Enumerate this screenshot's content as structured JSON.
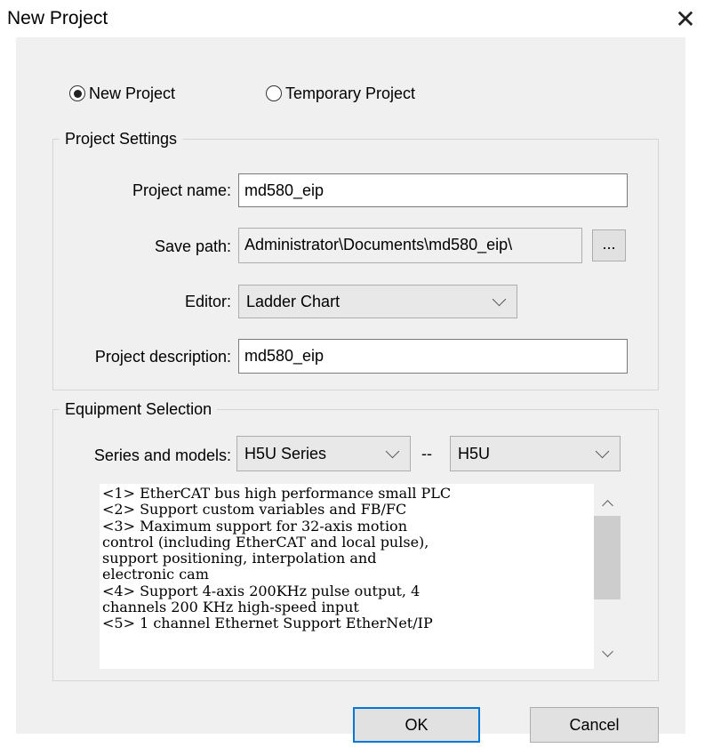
{
  "dialog": {
    "title": "New Project",
    "close_icon": "close-icon"
  },
  "project_type": {
    "options": [
      {
        "label": "New Project",
        "selected": true
      },
      {
        "label": "Temporary Project",
        "selected": false
      }
    ]
  },
  "project_settings": {
    "legend": "Project Settings",
    "name_label": "Project name:",
    "name_value": "md580_eip",
    "path_label": "Save path:",
    "path_value": "Administrator\\Documents\\md580_eip\\",
    "browse_label": "...",
    "editor_label": "Editor:",
    "editor_value": "Ladder Chart",
    "description_label": "Project description:",
    "description_value": "md580_eip"
  },
  "equipment": {
    "legend": "Equipment Selection",
    "series_label": "Series and models:",
    "series_value": "H5U Series",
    "separator": "--",
    "model_value": "H5U",
    "description_lines": [
      "<1> EtherCAT bus high performance small PLC",
      "<2> Support custom variables and FB/FC",
      "<3> Maximum support for 32-axis motion",
      "control (including EtherCAT and local pulse),",
      "support positioning, interpolation and",
      "electronic cam",
      "<4> Support 4-axis 200KHz pulse output, 4",
      "channels 200 KHz high-speed input",
      "<5> 1 channel Ethernet Support EtherNet/IP"
    ]
  },
  "buttons": {
    "ok": "OK",
    "cancel": "Cancel"
  }
}
